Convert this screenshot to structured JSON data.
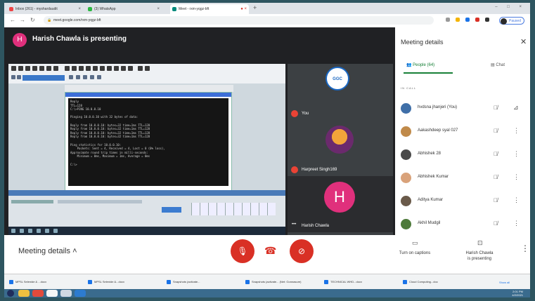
{
  "browser": {
    "tabs": [
      {
        "label": "Inbox (261) - myshardaudit"
      },
      {
        "label": "(3) WhatsApp"
      },
      {
        "label": "Meet - rxm-yqgz-bft",
        "active": true
      }
    ],
    "url": "meet.google.com/rxm-yqgz-bft",
    "profile_label": "Paused"
  },
  "meet": {
    "presenter_initial": "H",
    "presenting_title": "Harish Chawla is presenting",
    "terminal_lines": [
      "Reply",
      "TTL=128",
      "C:\\>PING 10.0.0.10",
      "",
      "Pinging 10.0.0.10 with 32 bytes of data:",
      "",
      "Reply from 10.0.0.10: bytes=32 time=1ms TTL=128",
      "Reply from 10.0.0.10: bytes=32 time=1ms TTL=128",
      "Reply from 10.0.0.10: bytes=32 time=1ms TTL=128",
      "Reply from 10.0.0.10: bytes=32 time=1ms TTL=128",
      "",
      "Ping statistics for 10.0.0.10:",
      "    Packets: Sent = 4, Received = 4, Lost = 0 (0% loss),",
      "Approximate round trip times in milli-seconds:",
      "    Minimum = 0ms, Maximum = 1ms, Average = 0ms",
      "",
      "C:\\>"
    ],
    "tiles": [
      {
        "name": "You",
        "avatar_text": "GGC"
      },
      {
        "name": "Harpreet Singh169"
      },
      {
        "name": "Harish Chawla",
        "initial": "H"
      }
    ]
  },
  "panel": {
    "title": "Meeting details",
    "tabs": [
      {
        "label": "People (64)",
        "icon": "people-icon"
      },
      {
        "label": "Chat",
        "icon": "chat-icon"
      }
    ],
    "section": "IN CALL",
    "people": [
      {
        "name": "hvdsna jhanjeri (You)",
        "avatar_color": "#3f6fa8"
      },
      {
        "name": "Aakashdeep syal 027",
        "avatar_color": "#c08a4a"
      },
      {
        "name": "Abhishek 28",
        "avatar_color": "#4a4a4a"
      },
      {
        "name": "Abhishek Kumar",
        "avatar_color": "#d9a27a"
      },
      {
        "name": "Aditya Kumar",
        "avatar_color": "#6a5a4a"
      },
      {
        "name": "Akhil Mudgil",
        "avatar_color": "#4d7a3a"
      }
    ]
  },
  "controls": {
    "meeting_details": "Meeting details",
    "captions": "Turn on captions",
    "presenting_line1": "Harish Chawla",
    "presenting_line2": "is presenting"
  },
  "downloads": {
    "items": [
      {
        "label": "MPSL Selenide & ...docx"
      },
      {
        "label": "MPSL Selenide &...docx"
      },
      {
        "label": "Snapshots (activate..."
      },
      {
        "label": "Snapshots (activate...  (Net: Gonnasure)"
      },
      {
        "label": "TECHNICAL WHD...docx"
      },
      {
        "label": "Cloud Computing...doc"
      }
    ],
    "show_all": "Show all"
  },
  "taskbar": {
    "time": "2:01 PM",
    "date": "4/2/2021"
  }
}
